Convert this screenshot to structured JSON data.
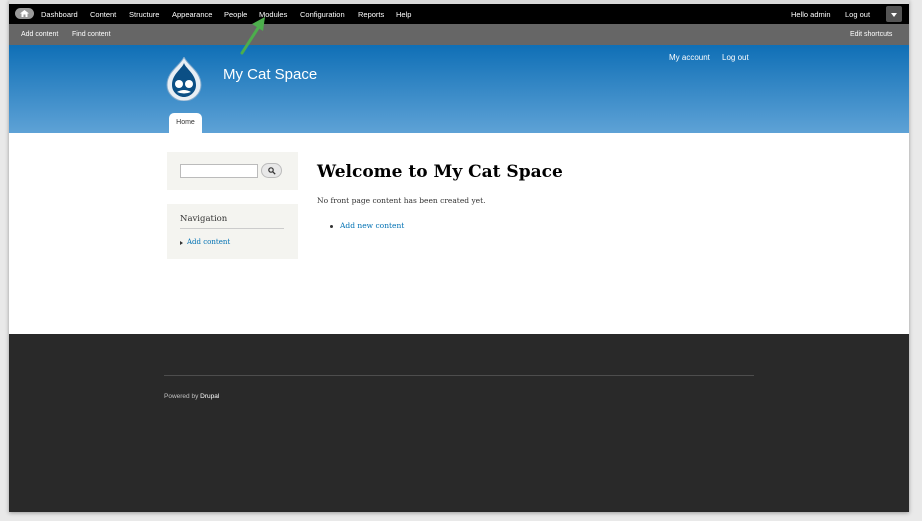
{
  "toolbar": {
    "items": [
      "Dashboard",
      "Content",
      "Structure",
      "Appearance",
      "People",
      "Modules",
      "Configuration",
      "Reports",
      "Help"
    ],
    "greeting": "Hello admin",
    "logout": "Log out"
  },
  "shortcuts": {
    "add_content": "Add content",
    "find_content": "Find content",
    "edit_shortcuts": "Edit shortcuts"
  },
  "header": {
    "site_name": "My Cat Space",
    "my_account": "My account",
    "logout": "Log out",
    "tab_home": "Home",
    "accent": "#0f6fb6"
  },
  "sidebar": {
    "navigation_title": "Navigation",
    "add_content": "Add content"
  },
  "main": {
    "title": "Welcome to My Cat Space",
    "message": "No front page content has been created yet.",
    "add_new_content": "Add new content"
  },
  "footer": {
    "powered_by": "Powered by",
    "drupal": "Drupal"
  },
  "annotation": {
    "arrow_color": "#4cae4c"
  }
}
